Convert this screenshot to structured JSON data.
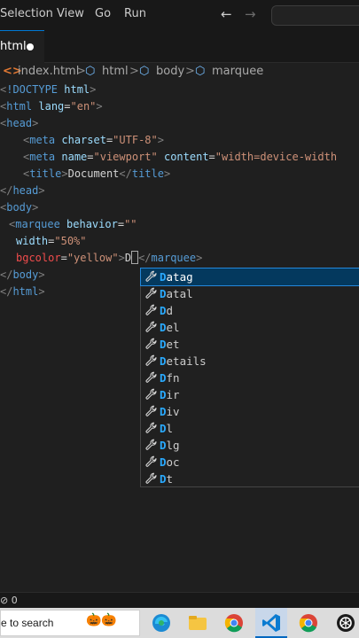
{
  "menubar": {
    "items": [
      "Selection",
      "View",
      "Go",
      "Run"
    ],
    "back_arrow": "←",
    "forward_arrow": "→"
  },
  "tabs": [
    {
      "label": "html",
      "modified": true
    }
  ],
  "breadcrumb": {
    "items": [
      "index.html",
      "html",
      "body",
      "marquee"
    ],
    "separator": ">"
  },
  "code": {
    "line1": {
      "punct_open": "<",
      "doctype": "!DOCTYPE",
      "name": " html",
      "punct_close": ">"
    },
    "line2": {
      "open": "<",
      "tag": "html",
      "attr": " lang",
      "eq": "=",
      "val": "\"en\"",
      "close": ">"
    },
    "line3": {
      "open": "<",
      "tag": "head",
      "close": ">"
    },
    "line4": {
      "open": "<",
      "tag": "meta",
      "attr": " charset",
      "eq": "=",
      "val": "\"UTF-8\"",
      "close": ">"
    },
    "line5": {
      "open": "<",
      "tag": "meta",
      "attr1": " name",
      "eq1": "=",
      "val1": "\"viewport\"",
      "attr2": " content",
      "eq2": "=",
      "val2": "\"width=device-width"
    },
    "line6": {
      "open": "<",
      "tag": "title",
      "close": ">",
      "text": "Document",
      "end_open": "</",
      "end_tag": "title",
      "end_close": ">"
    },
    "line7": {
      "open": "</",
      "tag": "head",
      "close": ">"
    },
    "line8": {
      "open": "<",
      "tag": "body",
      "close": ">"
    },
    "line9": {
      "open": "<",
      "tag": "marquee",
      "attr": " behavior",
      "eq": "=",
      "val": "\"\""
    },
    "line10": {
      "attr": "width",
      "eq": "=",
      "val_start": "\"",
      "val_end": "50%\""
    },
    "line11": {
      "attr": "bgcolor",
      "eq": "=",
      "val": "\"yellow\"",
      "close": ">",
      "typed": "D",
      "end_open": "</",
      "end_tag": "marquee",
      "end_close": ">"
    },
    "line12": {
      "open": "</",
      "tag": "body",
      "close": ">"
    },
    "line13": {
      "open": "</",
      "tag": "html",
      "close": ">"
    }
  },
  "suggestions": [
    {
      "match": "D",
      "rest": "atag",
      "selected": true
    },
    {
      "match": "D",
      "rest": "atal"
    },
    {
      "match": "D",
      "rest": "d"
    },
    {
      "match": "D",
      "rest": "el"
    },
    {
      "match": "D",
      "rest": "et"
    },
    {
      "match": "D",
      "rest": "etails"
    },
    {
      "match": "D",
      "rest": "fn"
    },
    {
      "match": "D",
      "rest": "ir"
    },
    {
      "match": "D",
      "rest": "iv"
    },
    {
      "match": "D",
      "rest": "l"
    },
    {
      "match": "D",
      "rest": "lg"
    },
    {
      "match": "D",
      "rest": "oc"
    },
    {
      "match": "D",
      "rest": "t"
    }
  ],
  "statusbar": {
    "text": "⊘ 0"
  },
  "taskbar": {
    "search_text": "e to search",
    "pumpkins": "🎃🎃"
  },
  "colors": {
    "accent": "#0078d4",
    "suggest_selected": "#04395e",
    "match_highlight": "#2aaaff"
  }
}
